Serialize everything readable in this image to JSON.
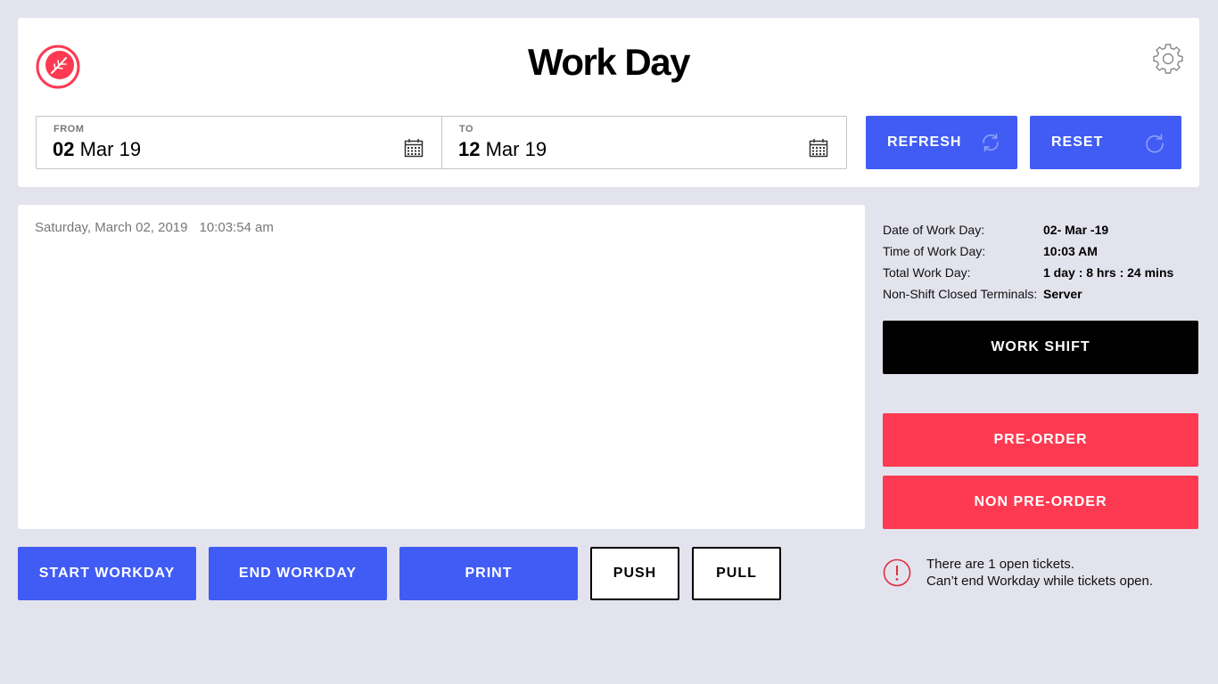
{
  "header": {
    "title": "Work Day",
    "brand_color": "#fd3a52",
    "logo_icon": "leaf-logo-icon",
    "settings_icon": "gear-icon"
  },
  "date_range": {
    "from": {
      "caption": "FROM",
      "day": "02",
      "rest": "Mar 19"
    },
    "to": {
      "caption": "TO",
      "day": "12",
      "rest": "Mar 19"
    },
    "icon": "calendar-icon"
  },
  "actions": {
    "refresh_label": "REFRESH",
    "reset_label": "RESET"
  },
  "log": {
    "date": "Saturday, March 02, 2019",
    "time": "10:03:54 am"
  },
  "info": [
    {
      "label": "Date of Work Day:",
      "value": "02- Mar -19"
    },
    {
      "label": "Time of Work Day:",
      "value": "10:03 AM"
    },
    {
      "label": "Total Work Day:",
      "value": "1 day : 8 hrs : 24 mins"
    },
    {
      "label": "Non-Shift Closed Terminals:",
      "value": "Server"
    }
  ],
  "side_buttons": {
    "work_shift": "WORK SHIFT",
    "pre_order": "PRE-ORDER",
    "non_pre_order": "NON PRE-ORDER"
  },
  "bottom_buttons": {
    "start": "START WORKDAY",
    "end": "END WORKDAY",
    "print": "PRINT",
    "push": "PUSH",
    "pull": "PULL"
  },
  "warning": {
    "line1": "There are 1 open tickets.",
    "line2": "Can’t end Workday while tickets open.",
    "icon": "alert-circle-icon"
  },
  "colors": {
    "primary_blue": "#405cf5",
    "accent_red": "#fd3a52",
    "background": "#e3e3ee"
  }
}
